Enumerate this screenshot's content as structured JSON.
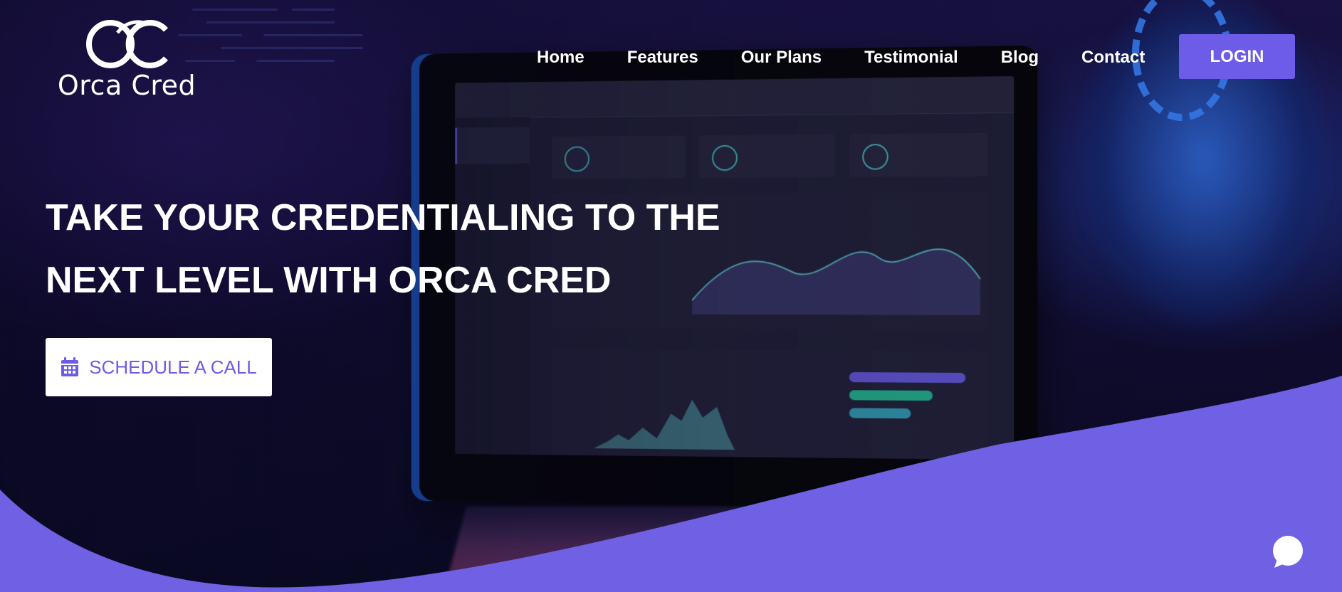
{
  "brand": {
    "name": "Orca Cred",
    "logo_icon": "orca-cred-logo-icon"
  },
  "nav": {
    "items": [
      {
        "label": "Home"
      },
      {
        "label": "Features"
      },
      {
        "label": "Our Plans"
      },
      {
        "label": "Testimonial"
      },
      {
        "label": "Blog"
      },
      {
        "label": "Contact"
      }
    ],
    "login_label": "LOGIN"
  },
  "hero": {
    "headline_line1": "TAKE YOUR CREDENTIALING TO THE",
    "headline_line2": "NEXT LEVEL WITH ORCA CRED",
    "cta_label": "SCHEDULE A CALL",
    "cta_icon": "calendar-icon"
  },
  "chat_widget": {
    "icon": "chat-bubble-icon"
  },
  "colors": {
    "accent": "#6c5ce7",
    "wave": "#7060e4",
    "text_light": "#ffffff"
  }
}
